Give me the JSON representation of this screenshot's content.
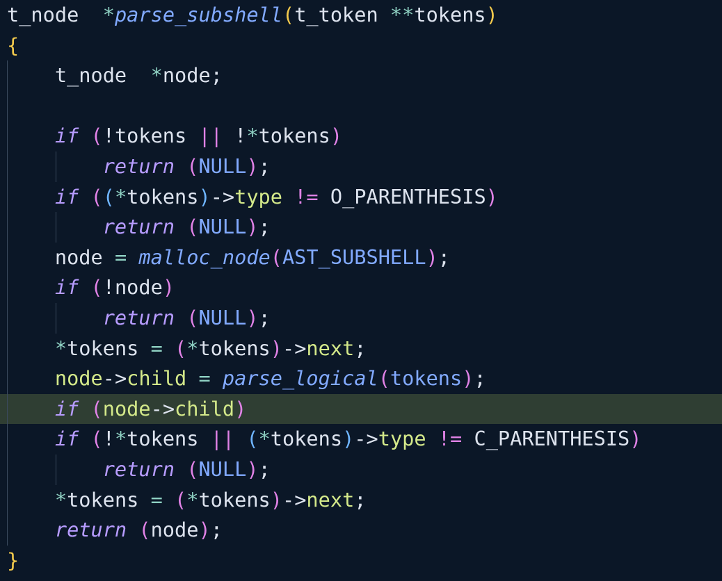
{
  "editor": {
    "language": "c",
    "highlighted_line": 14,
    "colors": {
      "background": "#0b1727",
      "highlight": "#2f3e33",
      "keyword": "#b79cff",
      "function": "#82aaff",
      "brace": "#f2c94c",
      "paren": "#e082e6",
      "field": "#d4e98a",
      "operator": "#8fd1c3"
    },
    "lines": [
      {
        "tokens": [
          [
            "t-type",
            "t_node  "
          ],
          [
            "t-op",
            "*"
          ],
          [
            "t-fn",
            "parse_subshell"
          ],
          [
            "t-brace",
            "("
          ],
          [
            "t-type",
            "t_token "
          ],
          [
            "t-op",
            "**"
          ],
          [
            "t-plain",
            "tokens"
          ],
          [
            "t-brace",
            ")"
          ]
        ]
      },
      {
        "tokens": [
          [
            "t-brace",
            "{"
          ]
        ]
      },
      {
        "tokens": [
          [
            "t-type",
            "    t_node  "
          ],
          [
            "t-op",
            "*"
          ],
          [
            "t-plain",
            "node;"
          ]
        ]
      },
      {
        "tokens": []
      },
      {
        "tokens": [
          [
            "t-kw",
            "    if "
          ],
          [
            "t-paren",
            "("
          ],
          [
            "t-plain",
            "!tokens "
          ],
          [
            "t-paren",
            "||"
          ],
          [
            "t-plain",
            " !"
          ],
          [
            "t-op",
            "*"
          ],
          [
            "t-plain",
            "tokens"
          ],
          [
            "t-paren",
            ")"
          ]
        ]
      },
      {
        "tokens": [
          [
            "t-kw",
            "        return "
          ],
          [
            "t-paren",
            "("
          ],
          [
            "t-const",
            "NULL"
          ],
          [
            "t-paren",
            ")"
          ],
          [
            "t-punct",
            ";"
          ]
        ]
      },
      {
        "tokens": [
          [
            "t-kw",
            "    if "
          ],
          [
            "t-paren",
            "("
          ],
          [
            "t-paren2",
            "("
          ],
          [
            "t-op",
            "*"
          ],
          [
            "t-plain",
            "tokens"
          ],
          [
            "t-paren2",
            ")"
          ],
          [
            "t-plain",
            "->"
          ],
          [
            "t-field",
            "type"
          ],
          [
            "t-plain",
            " "
          ],
          [
            "t-paren",
            "!="
          ],
          [
            "t-plain",
            " O_PARENTHESIS"
          ],
          [
            "t-paren",
            ")"
          ]
        ]
      },
      {
        "tokens": [
          [
            "t-kw",
            "        return "
          ],
          [
            "t-paren",
            "("
          ],
          [
            "t-const",
            "NULL"
          ],
          [
            "t-paren",
            ")"
          ],
          [
            "t-punct",
            ";"
          ]
        ]
      },
      {
        "tokens": [
          [
            "t-plain",
            "    node "
          ],
          [
            "t-op",
            "="
          ],
          [
            "t-plain",
            " "
          ],
          [
            "t-call",
            "malloc_node"
          ],
          [
            "t-paren",
            "("
          ],
          [
            "t-const",
            "AST_SUBSHELL"
          ],
          [
            "t-paren",
            ")"
          ],
          [
            "t-punct",
            ";"
          ]
        ]
      },
      {
        "tokens": [
          [
            "t-kw",
            "    if "
          ],
          [
            "t-paren",
            "("
          ],
          [
            "t-plain",
            "!node"
          ],
          [
            "t-paren",
            ")"
          ]
        ]
      },
      {
        "tokens": [
          [
            "t-kw",
            "        return "
          ],
          [
            "t-paren",
            "("
          ],
          [
            "t-const",
            "NULL"
          ],
          [
            "t-paren",
            ")"
          ],
          [
            "t-punct",
            ";"
          ]
        ]
      },
      {
        "tokens": [
          [
            "t-op",
            "    *"
          ],
          [
            "t-plain",
            "tokens "
          ],
          [
            "t-op",
            "="
          ],
          [
            "t-plain",
            " "
          ],
          [
            "t-paren",
            "("
          ],
          [
            "t-op",
            "*"
          ],
          [
            "t-plain",
            "tokens"
          ],
          [
            "t-paren",
            ")"
          ],
          [
            "t-plain",
            "->"
          ],
          [
            "t-field",
            "next"
          ],
          [
            "t-punct",
            ";"
          ]
        ]
      },
      {
        "tokens": [
          [
            "t-var",
            "    node"
          ],
          [
            "t-plain",
            "->"
          ],
          [
            "t-field",
            "child"
          ],
          [
            "t-plain",
            " "
          ],
          [
            "t-op",
            "="
          ],
          [
            "t-plain",
            " "
          ],
          [
            "t-call",
            "parse_logical"
          ],
          [
            "t-paren",
            "("
          ],
          [
            "t-const",
            "tokens"
          ],
          [
            "t-paren",
            ")"
          ],
          [
            "t-punct",
            ";"
          ]
        ]
      },
      {
        "tokens": [
          [
            "t-kw",
            "    if "
          ],
          [
            "t-paren",
            "("
          ],
          [
            "t-var",
            "node"
          ],
          [
            "t-plain",
            "->"
          ],
          [
            "t-field",
            "child"
          ],
          [
            "t-paren",
            ")"
          ]
        ]
      },
      {
        "tokens": [
          [
            "t-kw",
            "    if "
          ],
          [
            "t-paren",
            "("
          ],
          [
            "t-plain",
            "!"
          ],
          [
            "t-op",
            "*"
          ],
          [
            "t-plain",
            "tokens "
          ],
          [
            "t-paren",
            "||"
          ],
          [
            "t-plain",
            " "
          ],
          [
            "t-paren2",
            "("
          ],
          [
            "t-op",
            "*"
          ],
          [
            "t-plain",
            "tokens"
          ],
          [
            "t-paren2",
            ")"
          ],
          [
            "t-plain",
            "->"
          ],
          [
            "t-field",
            "type"
          ],
          [
            "t-plain",
            " "
          ],
          [
            "t-paren",
            "!="
          ],
          [
            "t-plain",
            " C_PARENTHESIS"
          ],
          [
            "t-paren",
            ")"
          ]
        ]
      },
      {
        "tokens": [
          [
            "t-kw",
            "        return "
          ],
          [
            "t-paren",
            "("
          ],
          [
            "t-const",
            "NULL"
          ],
          [
            "t-paren",
            ")"
          ],
          [
            "t-punct",
            ";"
          ]
        ]
      },
      {
        "tokens": [
          [
            "t-op",
            "    *"
          ],
          [
            "t-plain",
            "tokens "
          ],
          [
            "t-op",
            "="
          ],
          [
            "t-plain",
            " "
          ],
          [
            "t-paren",
            "("
          ],
          [
            "t-op",
            "*"
          ],
          [
            "t-plain",
            "tokens"
          ],
          [
            "t-paren",
            ")"
          ],
          [
            "t-plain",
            "->"
          ],
          [
            "t-field",
            "next"
          ],
          [
            "t-punct",
            ";"
          ]
        ]
      },
      {
        "tokens": [
          [
            "t-kw",
            "    return "
          ],
          [
            "t-paren",
            "("
          ],
          [
            "t-plain",
            "node"
          ],
          [
            "t-paren",
            ")"
          ],
          [
            "t-punct",
            ";"
          ]
        ]
      },
      {
        "tokens": [
          [
            "t-brace",
            "}"
          ]
        ]
      }
    ]
  }
}
